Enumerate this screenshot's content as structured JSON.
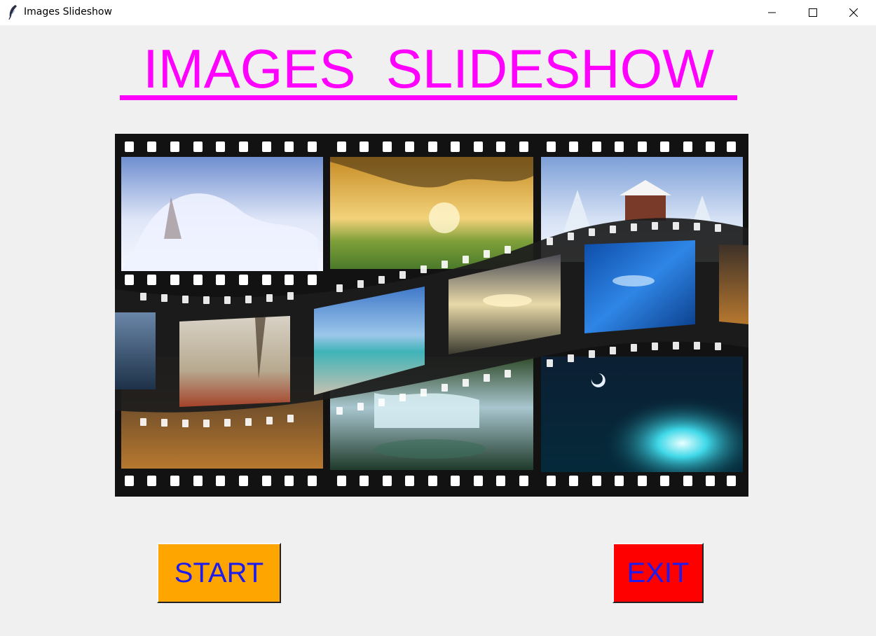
{
  "window": {
    "title": "Images Slideshow",
    "icons": [
      "feather-icon",
      "minimize-icon",
      "maximize-icon",
      "close-icon"
    ]
  },
  "main": {
    "title": "IMAGES  SLIDESHOW",
    "title_color": "#ff00ff",
    "image_description": "film strip collage of nature photos"
  },
  "buttons": {
    "start_label": "START",
    "exit_label": "EXIT",
    "start_color": "#ffa500",
    "exit_color": "#ff0000",
    "text_color": "#1c1cf0"
  }
}
